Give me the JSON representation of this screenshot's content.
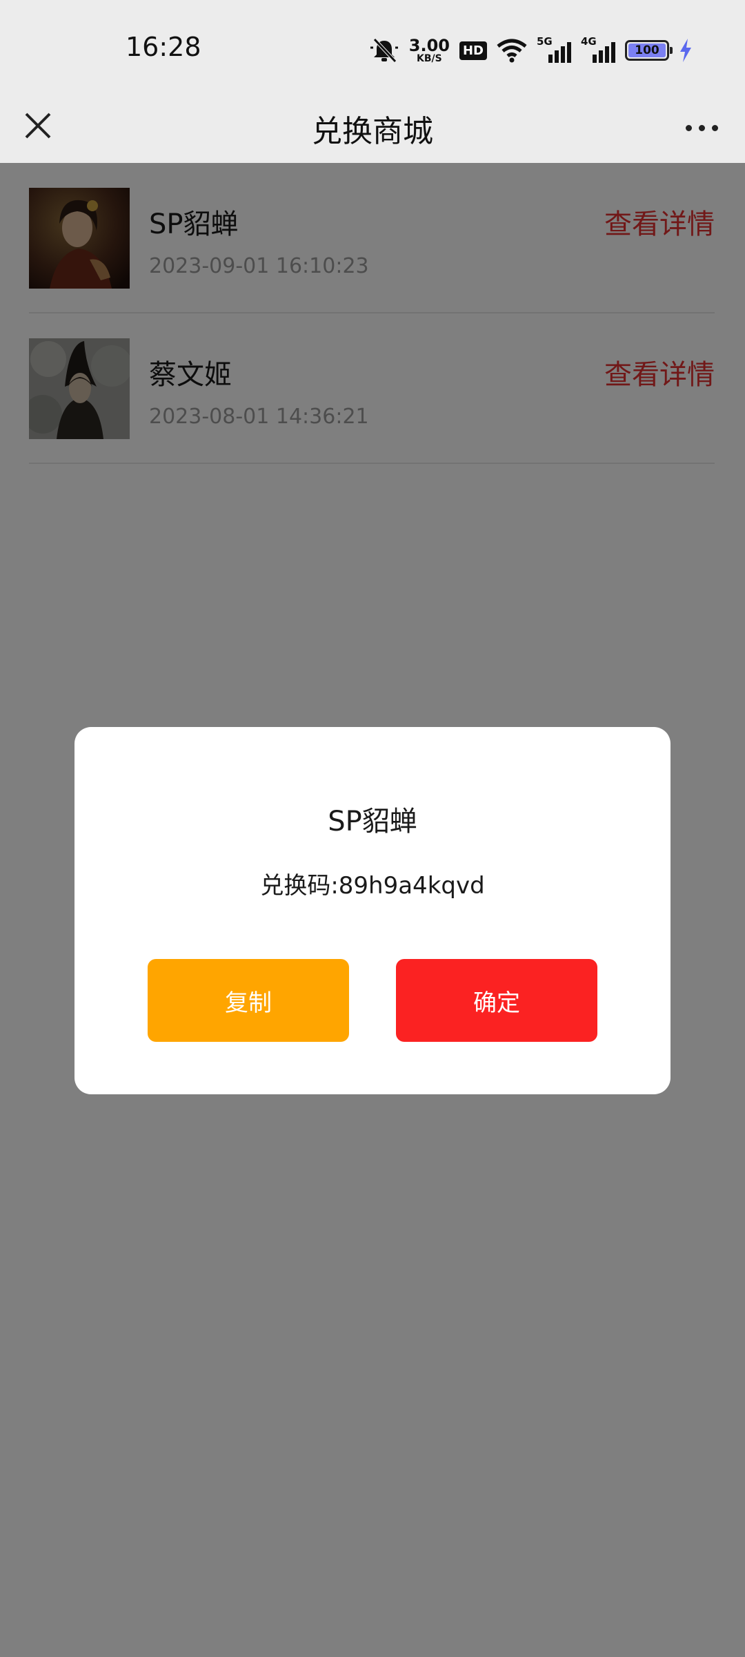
{
  "status_bar": {
    "time": "16:28",
    "net_speed_value": "3.00",
    "net_speed_unit": "KB/S",
    "hd_badge": "HD",
    "sim1_label": "5G",
    "sim2_label": "4G",
    "battery_level": "100",
    "icons": [
      "mute-bell-icon",
      "wifi-icon",
      "signal-5g-icon",
      "signal-4g-icon",
      "battery-icon",
      "charging-icon"
    ]
  },
  "navbar": {
    "title": "兑换商城",
    "left_icon": "close-icon",
    "right_icon": "more-icon"
  },
  "list": {
    "items": [
      {
        "name": "SP貂蝉",
        "time": "2023-09-01 16:10:23",
        "link": "查看详情"
      },
      {
        "name": "蔡文姬",
        "time": "2023-08-01 14:36:21",
        "link": "查看详情"
      }
    ]
  },
  "modal": {
    "title": "SP貂蝉",
    "code_text": "兑换码:89h9a4kqvd",
    "copy_label": "复制",
    "confirm_label": "确定"
  },
  "colors": {
    "accent_red": "#e33030",
    "copy_button": "#ffa500",
    "confirm_button": "#fb2222",
    "header_bg": "#ececec",
    "battery_fill": "#7b80f2"
  }
}
